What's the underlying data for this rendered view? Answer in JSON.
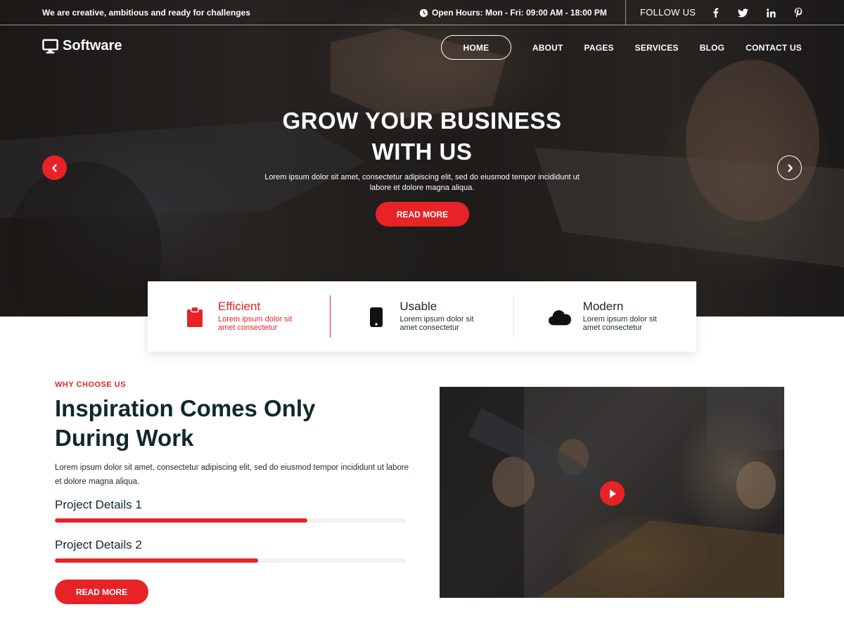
{
  "topbar": {
    "tagline": "We are creative, ambitious and ready for challenges",
    "hours": "Open Hours: Mon - Fri: 09:00 AM - 18:00 PM",
    "follow_label": "FOLLOW US",
    "social_icons": [
      "facebook-icon",
      "twitter-icon",
      "linkedin-icon",
      "pinterest-icon"
    ]
  },
  "logo": {
    "text": "Software"
  },
  "nav": {
    "items": [
      {
        "label": "HOME",
        "active": true
      },
      {
        "label": "ABOUT"
      },
      {
        "label": "PAGES"
      },
      {
        "label": "SERVICES"
      },
      {
        "label": "BLOG"
      },
      {
        "label": "CONTACT US"
      }
    ]
  },
  "hero": {
    "title_line1": "GROW YOUR BUSINESS",
    "title_line2": "WITH US",
    "text": "Lorem ipsum dolor sit amet, consectetur adipiscing elit, sed do eiusmod tempor incididunt ut labore et dolore magna aliqua.",
    "button": "READ MORE"
  },
  "features": [
    {
      "title": "Efficient",
      "desc": "Lorem ipsum dolor sit amet consectetur",
      "icon": "clipboard-icon"
    },
    {
      "title": "Usable",
      "desc": "Lorem ipsum dolor sit amet consectetur",
      "icon": "mobile-icon"
    },
    {
      "title": "Modern",
      "desc": "Lorem ipsum dolor sit amet consectetur",
      "icon": "cloud-icon"
    }
  ],
  "about": {
    "eyebrow": "WHY CHOOSE US",
    "title_line1": "Inspiration Comes Only",
    "title_line2": "During Work",
    "text": "Lorem ipsum dolor sit amet, consectetur adipiscing elit, sed do eiusmod tempor incididunt ut labore et dolore magna aliqua.",
    "projects": [
      {
        "label": "Project Details 1",
        "percent": 72
      },
      {
        "label": "Project Details 2",
        "percent": 58
      }
    ],
    "button": "READ MORE"
  },
  "colors": {
    "accent": "#e72327",
    "heading": "#10282d"
  }
}
